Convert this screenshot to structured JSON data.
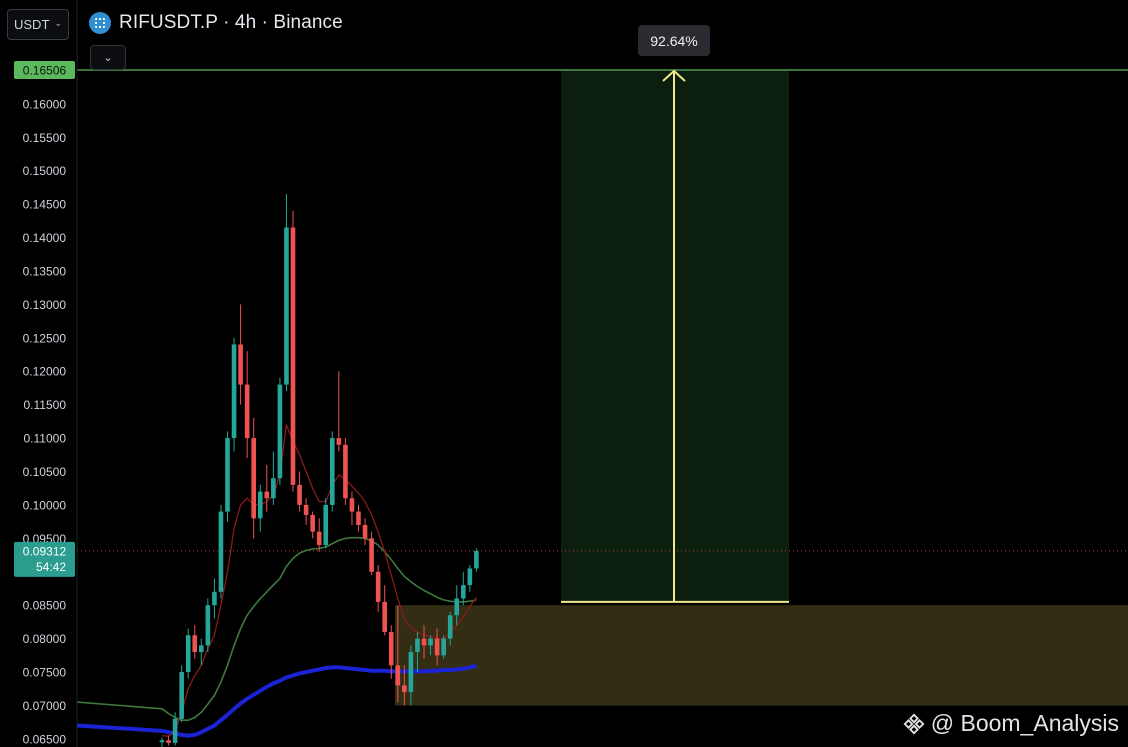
{
  "header": {
    "currency_selector": "USDT",
    "symbol_title": "RIFUSDT.P · 4h · Binance"
  },
  "overlay": {
    "measure_label": "92.64%",
    "watermark": "@ Boom_Analysis"
  },
  "colors": {
    "bull": "#26a69a",
    "bear": "#ef5350",
    "ma_fast": "#8b1a1a",
    "ma_mid": "#3e7a3e",
    "ma_slow": "#1a24d6",
    "target_line": "#5cb85c",
    "target_zone": "#0c1f0f",
    "demand_zone": "#322d13",
    "measure_arrow": "#f2e78c",
    "last_price_bg": "#2a9d8f"
  },
  "chart_data": {
    "type": "candlestick",
    "y_axis_ticks": [
      "0.16000",
      "0.15500",
      "0.15000",
      "0.14500",
      "0.14000",
      "0.13500",
      "0.13000",
      "0.12500",
      "0.12000",
      "0.11500",
      "0.11000",
      "0.10500",
      "0.10000",
      "0.09500",
      "0.08500",
      "0.08000",
      "0.07500",
      "0.07000",
      "0.06500"
    ],
    "ylim": [
      0.0648,
      0.17
    ],
    "target_price": "0.16506",
    "last_price": "0.09312",
    "countdown": "54:42",
    "demand_zone": [
      0.07,
      0.085
    ],
    "measure": {
      "from": 0.0855,
      "to": 0.16506,
      "percent": "92.64%"
    },
    "candles": [
      [
        0.0645,
        0.0652,
        0.0638,
        0.0648
      ],
      [
        0.0648,
        0.0655,
        0.064,
        0.0644
      ],
      [
        0.0644,
        0.069,
        0.064,
        0.068
      ],
      [
        0.068,
        0.076,
        0.0675,
        0.075
      ],
      [
        0.075,
        0.0815,
        0.074,
        0.0805
      ],
      [
        0.0805,
        0.082,
        0.077,
        0.078
      ],
      [
        0.078,
        0.08,
        0.076,
        0.079
      ],
      [
        0.079,
        0.086,
        0.078,
        0.085
      ],
      [
        0.085,
        0.089,
        0.083,
        0.087
      ],
      [
        0.087,
        0.1,
        0.086,
        0.099
      ],
      [
        0.099,
        0.111,
        0.0975,
        0.11
      ],
      [
        0.11,
        0.125,
        0.108,
        0.124
      ],
      [
        0.124,
        0.13,
        0.115,
        0.118
      ],
      [
        0.118,
        0.123,
        0.107,
        0.11
      ],
      [
        0.11,
        0.113,
        0.095,
        0.098
      ],
      [
        0.098,
        0.103,
        0.096,
        0.102
      ],
      [
        0.102,
        0.106,
        0.099,
        0.101
      ],
      [
        0.101,
        0.108,
        0.1,
        0.104
      ],
      [
        0.104,
        0.119,
        0.103,
        0.118
      ],
      [
        0.118,
        0.1465,
        0.117,
        0.1415
      ],
      [
        0.1415,
        0.144,
        0.102,
        0.103
      ],
      [
        0.103,
        0.105,
        0.099,
        0.1
      ],
      [
        0.1,
        0.101,
        0.097,
        0.0985
      ],
      [
        0.0985,
        0.099,
        0.095,
        0.096
      ],
      [
        0.096,
        0.098,
        0.093,
        0.094
      ],
      [
        0.094,
        0.101,
        0.0935,
        0.1
      ],
      [
        0.1,
        0.111,
        0.099,
        0.11
      ],
      [
        0.11,
        0.12,
        0.108,
        0.109
      ],
      [
        0.109,
        0.11,
        0.1,
        0.101
      ],
      [
        0.101,
        0.102,
        0.097,
        0.099
      ],
      [
        0.099,
        0.1,
        0.096,
        0.097
      ],
      [
        0.097,
        0.098,
        0.094,
        0.095
      ],
      [
        0.095,
        0.096,
        0.0895,
        0.09
      ],
      [
        0.09,
        0.091,
        0.084,
        0.0855
      ],
      [
        0.0855,
        0.088,
        0.0805,
        0.081
      ],
      [
        0.081,
        0.082,
        0.074,
        0.076
      ],
      [
        0.076,
        0.085,
        0.0705,
        0.073
      ],
      [
        0.073,
        0.076,
        0.07,
        0.072
      ],
      [
        0.072,
        0.079,
        0.07,
        0.078
      ],
      [
        0.078,
        0.081,
        0.075,
        0.08
      ],
      [
        0.08,
        0.082,
        0.077,
        0.079
      ],
      [
        0.079,
        0.0805,
        0.0775,
        0.08
      ],
      [
        0.08,
        0.0815,
        0.076,
        0.0775
      ],
      [
        0.0775,
        0.0805,
        0.077,
        0.08
      ],
      [
        0.08,
        0.084,
        0.079,
        0.0835
      ],
      [
        0.0835,
        0.088,
        0.082,
        0.086
      ],
      [
        0.086,
        0.09,
        0.085,
        0.088
      ],
      [
        0.088,
        0.091,
        0.087,
        0.0905
      ],
      [
        0.0905,
        0.0935,
        0.09,
        0.0931
      ]
    ],
    "ma_fast": [
      0.0655,
      0.0654,
      0.0662,
      0.069,
      0.0725,
      0.0745,
      0.076,
      0.0785,
      0.0805,
      0.085,
      0.09,
      0.0965,
      0.1,
      0.101,
      0.1,
      0.1,
      0.1005,
      0.1015,
      0.1045,
      0.112,
      0.1095,
      0.1075,
      0.105,
      0.1025,
      0.1005,
      0.1005,
      0.103,
      0.1045,
      0.1038,
      0.1028,
      0.1018,
      0.1005,
      0.0985,
      0.096,
      0.093,
      0.0895,
      0.086,
      0.083,
      0.0815,
      0.081,
      0.0805,
      0.0804,
      0.08,
      0.08,
      0.0808,
      0.082,
      0.0833,
      0.0848,
      0.0862
    ],
    "ma_mid": [
      0.0695,
      0.0688,
      0.0682,
      0.0678,
      0.0678,
      0.0682,
      0.069,
      0.0702,
      0.0715,
      0.0735,
      0.076,
      0.079,
      0.0815,
      0.0835,
      0.0848,
      0.086,
      0.087,
      0.088,
      0.089,
      0.0908,
      0.092,
      0.0928,
      0.0932,
      0.0934,
      0.0935,
      0.0937,
      0.0942,
      0.0947,
      0.095,
      0.0951,
      0.0951,
      0.095,
      0.0946,
      0.094,
      0.093,
      0.0918,
      0.0905,
      0.0893,
      0.0885,
      0.0878,
      0.0872,
      0.0867,
      0.0862,
      0.0858,
      0.0856,
      0.0855,
      0.0855,
      0.0856,
      0.0858
    ],
    "ma_slow": [
      0.0662,
      0.066,
      0.0658,
      0.0656,
      0.0655,
      0.0656,
      0.066,
      0.0665,
      0.067,
      0.0678,
      0.0686,
      0.0695,
      0.0703,
      0.071,
      0.0716,
      0.0722,
      0.0728,
      0.0733,
      0.0737,
      0.0742,
      0.0745,
      0.0748,
      0.075,
      0.0752,
      0.0754,
      0.0756,
      0.0757,
      0.0757,
      0.0756,
      0.0755,
      0.0754,
      0.0753,
      0.0752,
      0.0752,
      0.0752,
      0.0751,
      0.0751,
      0.0751,
      0.0751,
      0.0751,
      0.0751,
      0.0752,
      0.0752,
      0.0753,
      0.0753,
      0.0754,
      0.0755,
      0.0757,
      0.0759
    ]
  }
}
